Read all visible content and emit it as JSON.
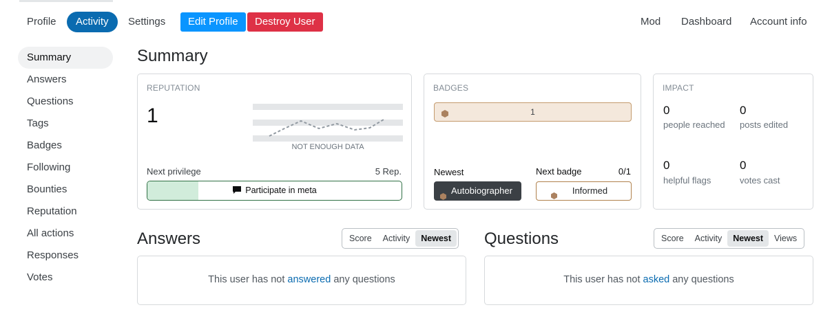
{
  "nav": {
    "tabs": [
      "Profile",
      "Activity",
      "Settings"
    ],
    "active_tab": "Activity",
    "edit_profile": "Edit Profile",
    "destroy_user": "Destroy User",
    "right_links": [
      "Mod",
      "Dashboard",
      "Account info"
    ]
  },
  "sidebar": {
    "items": [
      "Summary",
      "Answers",
      "Questions",
      "Tags",
      "Badges",
      "Following",
      "Bounties",
      "Reputation",
      "All actions",
      "Responses",
      "Votes"
    ],
    "active": "Summary"
  },
  "page_title": "Summary",
  "reputation": {
    "title": "REPUTATION",
    "value": "1",
    "graph_note": "NOT ENOUGH DATA",
    "next_privilege_label": "Next privilege",
    "next_privilege_rep": "5 Rep.",
    "privilege_name": "Participate in meta",
    "progress": 0.2
  },
  "badges": {
    "title": "BADGES",
    "bronze_count": "1",
    "newest_label": "Newest",
    "newest_badge": "Autobiographer",
    "next_badge_label": "Next badge",
    "next_badge_progress": "0/1",
    "next_badge": "Informed",
    "colors": {
      "bronze": "#ab8260",
      "bronze_bg": "#f4e8dc"
    }
  },
  "impact": {
    "title": "IMPACT",
    "people_reached": "0",
    "people_reached_label": "people reached",
    "posts_edited": "0",
    "posts_edited_label": "posts edited",
    "helpful_flags": "0",
    "helpful_flags_label": "helpful flags",
    "votes_cast": "0",
    "votes_cast_label": "votes cast"
  },
  "answers": {
    "title": "Answers",
    "sort": [
      "Score",
      "Activity",
      "Newest"
    ],
    "selected": "Newest",
    "empty_pre": "This user has not ",
    "empty_link": "answered",
    "empty_post": " any questions"
  },
  "questions": {
    "title": "Questions",
    "sort": [
      "Score",
      "Activity",
      "Newest",
      "Views"
    ],
    "selected": "Newest",
    "empty_pre": "This user has not ",
    "empty_link": "asked",
    "empty_post": " any questions"
  },
  "colors": {
    "accent": "#0a6bb0",
    "primary_button": "#0a95ff",
    "danger_button": "#de3146",
    "privilege_green": "#2f6f44"
  }
}
